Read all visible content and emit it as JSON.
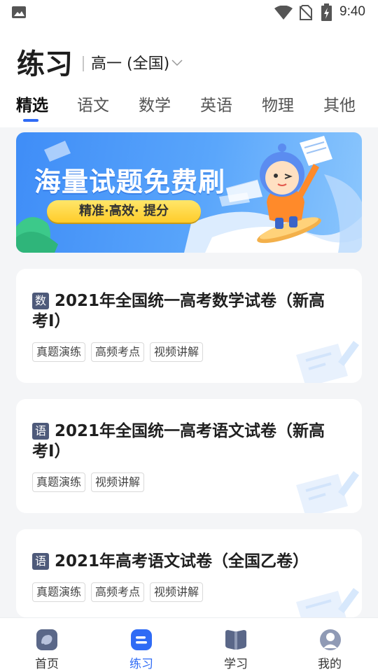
{
  "status_bar": {
    "time": "9:40"
  },
  "header": {
    "title": "练习",
    "grade": "高一 (全国)",
    "tabs": [
      {
        "label": "精选",
        "active": true
      },
      {
        "label": "语文",
        "active": false
      },
      {
        "label": "数学",
        "active": false
      },
      {
        "label": "英语",
        "active": false
      },
      {
        "label": "物理",
        "active": false
      },
      {
        "label": "其他",
        "active": false
      }
    ]
  },
  "banner": {
    "title": "海量试题免费刷",
    "subtitle": "精准·高效· 提分"
  },
  "cards": [
    {
      "badge": "数",
      "title": "2021年全国统一高考数学试卷（新高考I）",
      "tags": [
        "真题演练",
        "高频考点",
        "视频讲解"
      ]
    },
    {
      "badge": "语",
      "title": "2021年全国统一高考语文试卷（新高考I）",
      "tags": [
        "真题演练",
        "视频讲解"
      ]
    },
    {
      "badge": "语",
      "title": "2021年高考语文试卷（全国乙卷）",
      "tags": [
        "真题演练",
        "高频考点",
        "视频讲解"
      ]
    }
  ],
  "bottom_nav": [
    {
      "label": "首页",
      "icon": "home-icon",
      "active": false
    },
    {
      "label": "练习",
      "icon": "practice-icon",
      "active": true
    },
    {
      "label": "学习",
      "icon": "book-icon",
      "active": false
    },
    {
      "label": "我的",
      "icon": "profile-icon",
      "active": false
    }
  ],
  "colors": {
    "accent": "#2f6bf5",
    "badge": "#4e5a7a",
    "background": "#f4f5f7"
  }
}
